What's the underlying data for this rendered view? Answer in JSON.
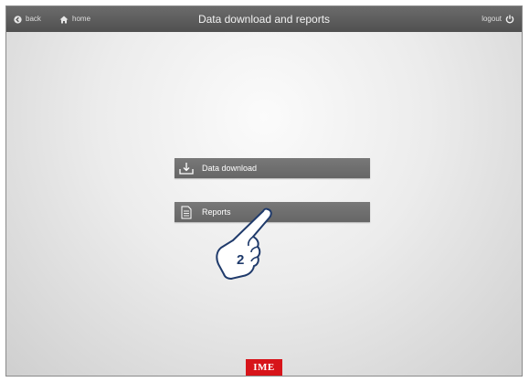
{
  "header": {
    "title": "Data download and reports",
    "back_label": "back",
    "home_label": "home",
    "logout_label": "logout"
  },
  "menu": {
    "items": [
      {
        "label": "Data download",
        "icon": "download-icon"
      },
      {
        "label": "Reports",
        "icon": "document-icon"
      }
    ]
  },
  "annotation": {
    "step_number": "2",
    "icon": "pointing-hand-icon"
  },
  "footer": {
    "logo_text": "IME",
    "logo_color": "#d7141a"
  },
  "colors": {
    "topbar": "#5c5c5c",
    "menu_button": "#707070"
  }
}
